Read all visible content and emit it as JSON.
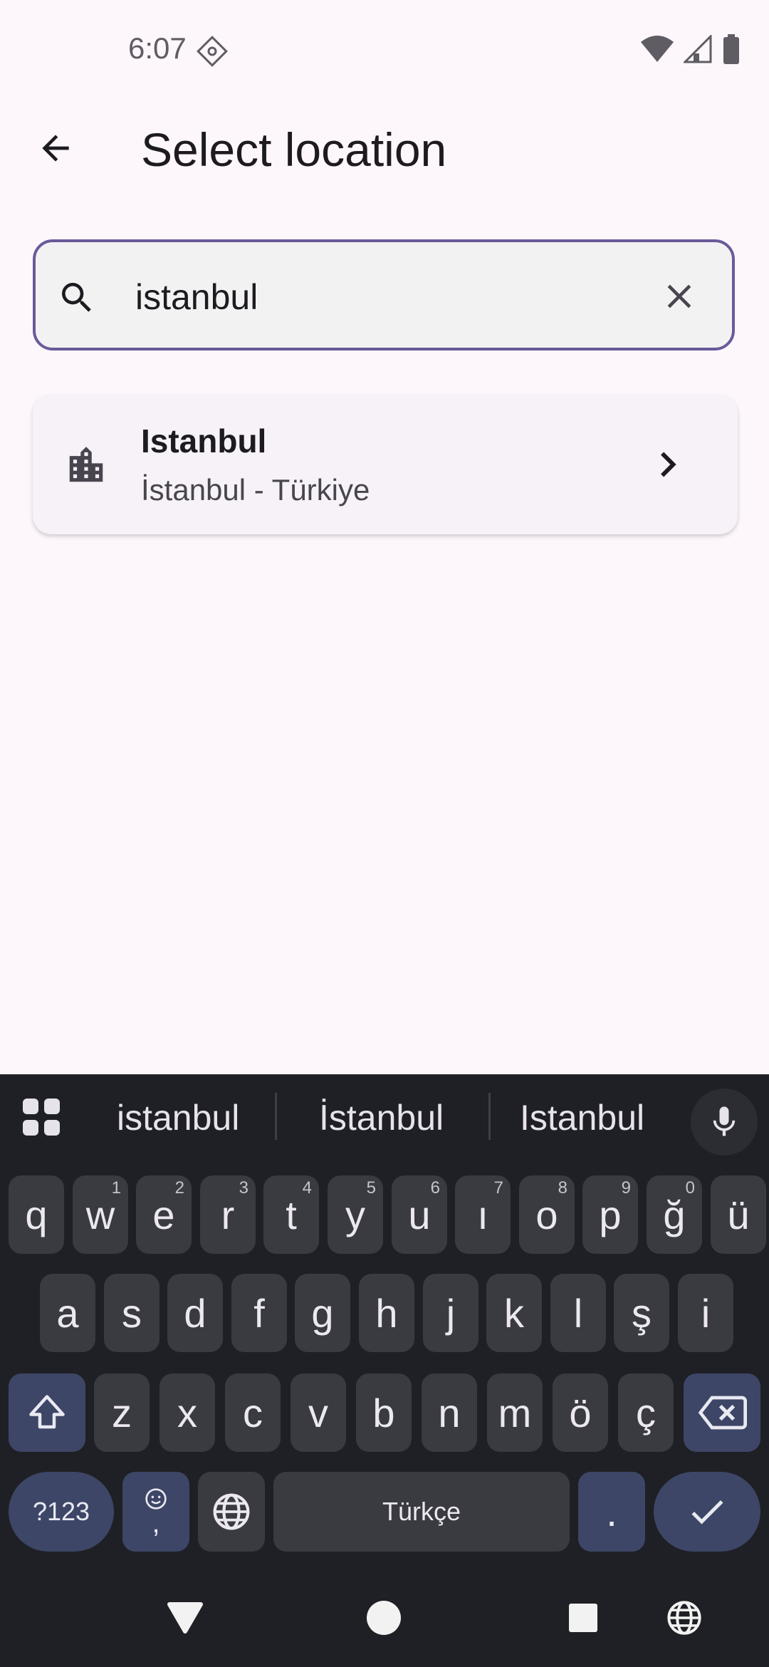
{
  "status_bar": {
    "time": "6:07"
  },
  "app_bar": {
    "title": "Select location"
  },
  "search": {
    "value": "istanbul"
  },
  "results": [
    {
      "title": "Istanbul",
      "subtitle": "İstanbul - Türkiye"
    }
  ],
  "keyboard": {
    "suggestions": [
      "istanbul",
      "İstanbul",
      "Istanbul"
    ],
    "row1": [
      {
        "k": "q",
        "h": ""
      },
      {
        "k": "w",
        "h": "1"
      },
      {
        "k": "e",
        "h": "2"
      },
      {
        "k": "r",
        "h": "3"
      },
      {
        "k": "t",
        "h": "4"
      },
      {
        "k": "y",
        "h": "5"
      },
      {
        "k": "u",
        "h": "6"
      },
      {
        "k": "ı",
        "h": "7"
      },
      {
        "k": "o",
        "h": "8"
      },
      {
        "k": "p",
        "h": "9"
      },
      {
        "k": "ğ",
        "h": "0"
      },
      {
        "k": "ü",
        "h": ""
      }
    ],
    "row2": [
      "a",
      "s",
      "d",
      "f",
      "g",
      "h",
      "j",
      "k",
      "l",
      "ş",
      "i"
    ],
    "row3": [
      "z",
      "x",
      "c",
      "v",
      "b",
      "n",
      "m",
      "ö",
      "ç"
    ],
    "symbols_label": "?123",
    "emoji_comma": ",",
    "space_label": "Türkçe",
    "period_label": "."
  },
  "colors": {
    "background": "#fdf7fc",
    "search_border": "#6a5a9a",
    "keyboard_bg": "#1f2025",
    "key_bg": "#3a3b40",
    "func_key_bg": "#3d4666"
  }
}
